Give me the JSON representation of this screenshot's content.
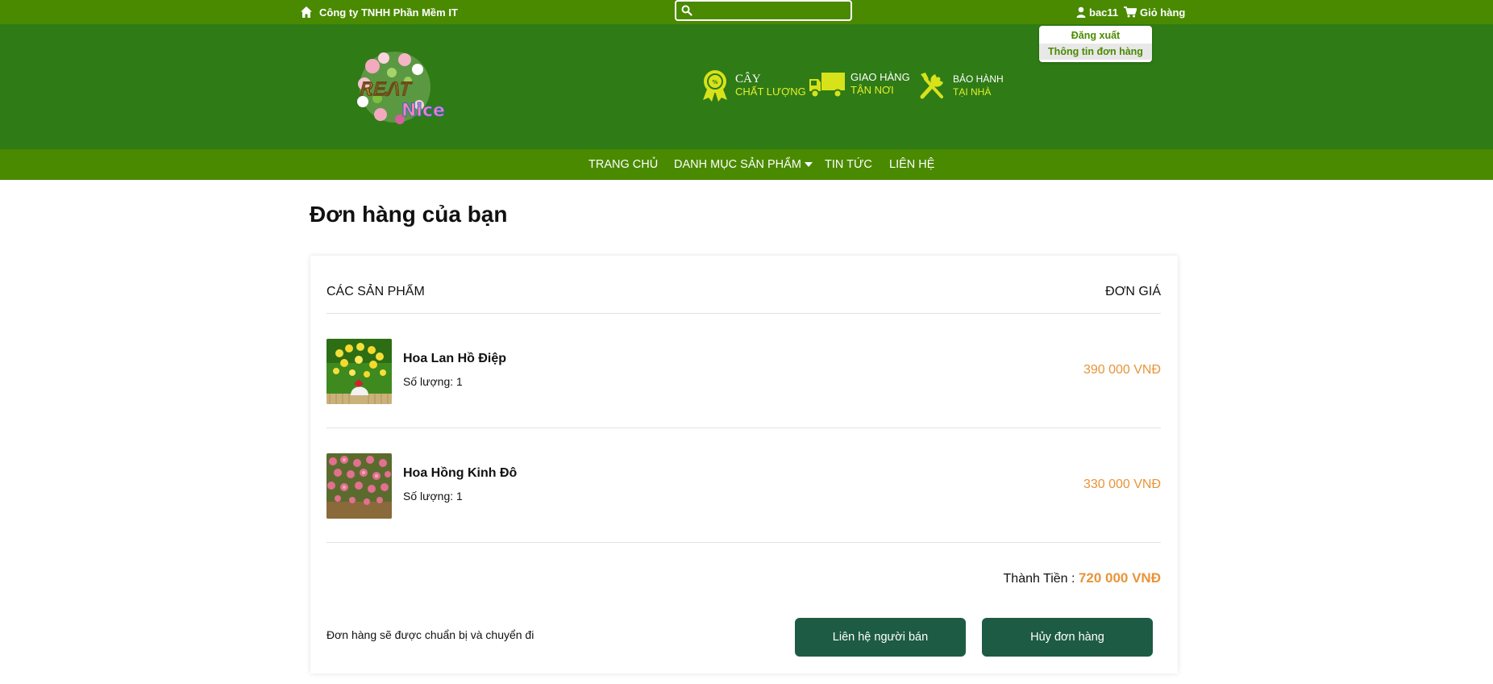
{
  "topbar": {
    "company": "Công ty TNHH Phần Mềm IT",
    "search_placeholder": "",
    "username": "bac11",
    "cart_label": "Giỏ hàng"
  },
  "user_menu": {
    "logout": "Đăng xuất",
    "order_info": "Thông tin đơn hàng"
  },
  "header": {
    "logo_text_line1": "ᎡᎬᏁᎢ",
    "logo_text_line2": "Nice",
    "features": [
      {
        "line1": "CÂY",
        "line2": "CHẤT LƯỢNG",
        "icon": "quality-badge-icon"
      },
      {
        "line1": "GIAO HÀNG",
        "line2": "TẬN NƠI",
        "icon": "delivery-truck-icon"
      },
      {
        "line1": "BẢO HÀNH",
        "line2": "TẠI NHÀ",
        "icon": "tools-icon"
      }
    ]
  },
  "nav": {
    "items": [
      "TRANG CHỦ",
      "DANH MỤC SẢN PHẨM",
      "TIN TỨC",
      "LIÊN HỆ"
    ]
  },
  "page": {
    "title": "Đơn hàng của bạn"
  },
  "order": {
    "col_products": "CÁC SẢN PHẨM",
    "col_price": "ĐƠN GIÁ",
    "items": [
      {
        "name": "Hoa Lan Hồ Điệp",
        "qty": "Số lượng: 1",
        "price": "390 000 VNĐ"
      },
      {
        "name": "Hoa Hồng Kinh Đô",
        "qty": "Số lượng: 1",
        "price": "330 000 VNĐ"
      }
    ],
    "total_label": "Thành Tiền :",
    "total_amount": "720 000 VNĐ",
    "status": "Đơn hàng sẽ được chuẩn bị và chuyển đi",
    "contact_button": "Liên hệ người bán",
    "cancel_button": "Hủy đơn hàng"
  },
  "colors": {
    "topbar": "#4a8a00",
    "header": "#2f7b16",
    "accent_price": "#e8943a",
    "button": "#1d5b45",
    "feature_highlight": "#e4ef2a"
  }
}
